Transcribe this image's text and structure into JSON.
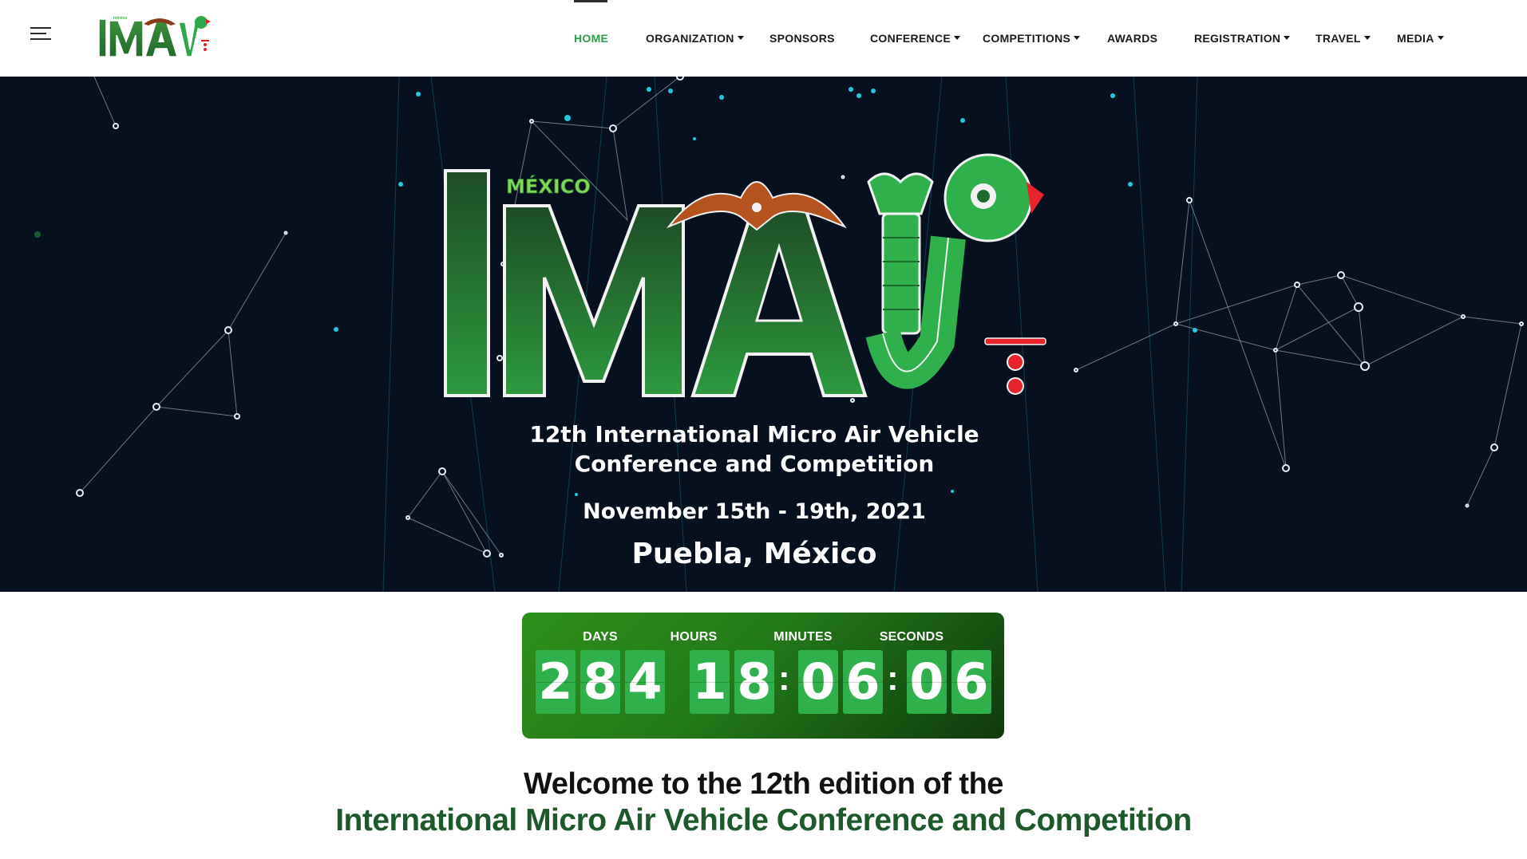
{
  "nav": {
    "logo_text": "IMAV",
    "logo_tag": "méxico",
    "items": [
      {
        "label": "HOME",
        "dropdown": false,
        "active": true
      },
      {
        "label": "ORGANIZATION",
        "dropdown": true
      },
      {
        "label": "SPONSORS",
        "dropdown": false
      },
      {
        "label": "CONFERENCE",
        "dropdown": true
      },
      {
        "label": "COMPETITIONS",
        "dropdown": true
      },
      {
        "label": "AWARDS",
        "dropdown": false
      },
      {
        "label": "REGISTRATION",
        "dropdown": true
      },
      {
        "label": "TRAVEL",
        "dropdown": true
      },
      {
        "label": "MEDIA",
        "dropdown": true
      }
    ]
  },
  "hero": {
    "logo_text": "IMAV",
    "logo_tag": "MÉXICO",
    "subtitle_line1": "12th International Micro Air Vehicle",
    "subtitle_line2": "Conference and Competition",
    "dates": "November 15th - 19th, 2021",
    "location": "Puebla, México"
  },
  "countdown": {
    "labels": {
      "days": "DAYS",
      "hours": "HOURS",
      "minutes": "MINUTES",
      "seconds": "SECONDS"
    },
    "days": [
      "2",
      "8",
      "4"
    ],
    "hours": [
      "1",
      "8"
    ],
    "minutes": [
      "0",
      "6"
    ],
    "seconds": [
      "0",
      "6"
    ],
    "separator": ":"
  },
  "welcome": {
    "line1": "Welcome to the 12th edition of the",
    "line2": "International Micro Air Vehicle Conference and Competition"
  },
  "colors": {
    "accent_green": "#2e9e48",
    "hero_bg": "#06101f",
    "heading_green": "#1c5a2c",
    "digit_bg": "#2fb04a"
  }
}
